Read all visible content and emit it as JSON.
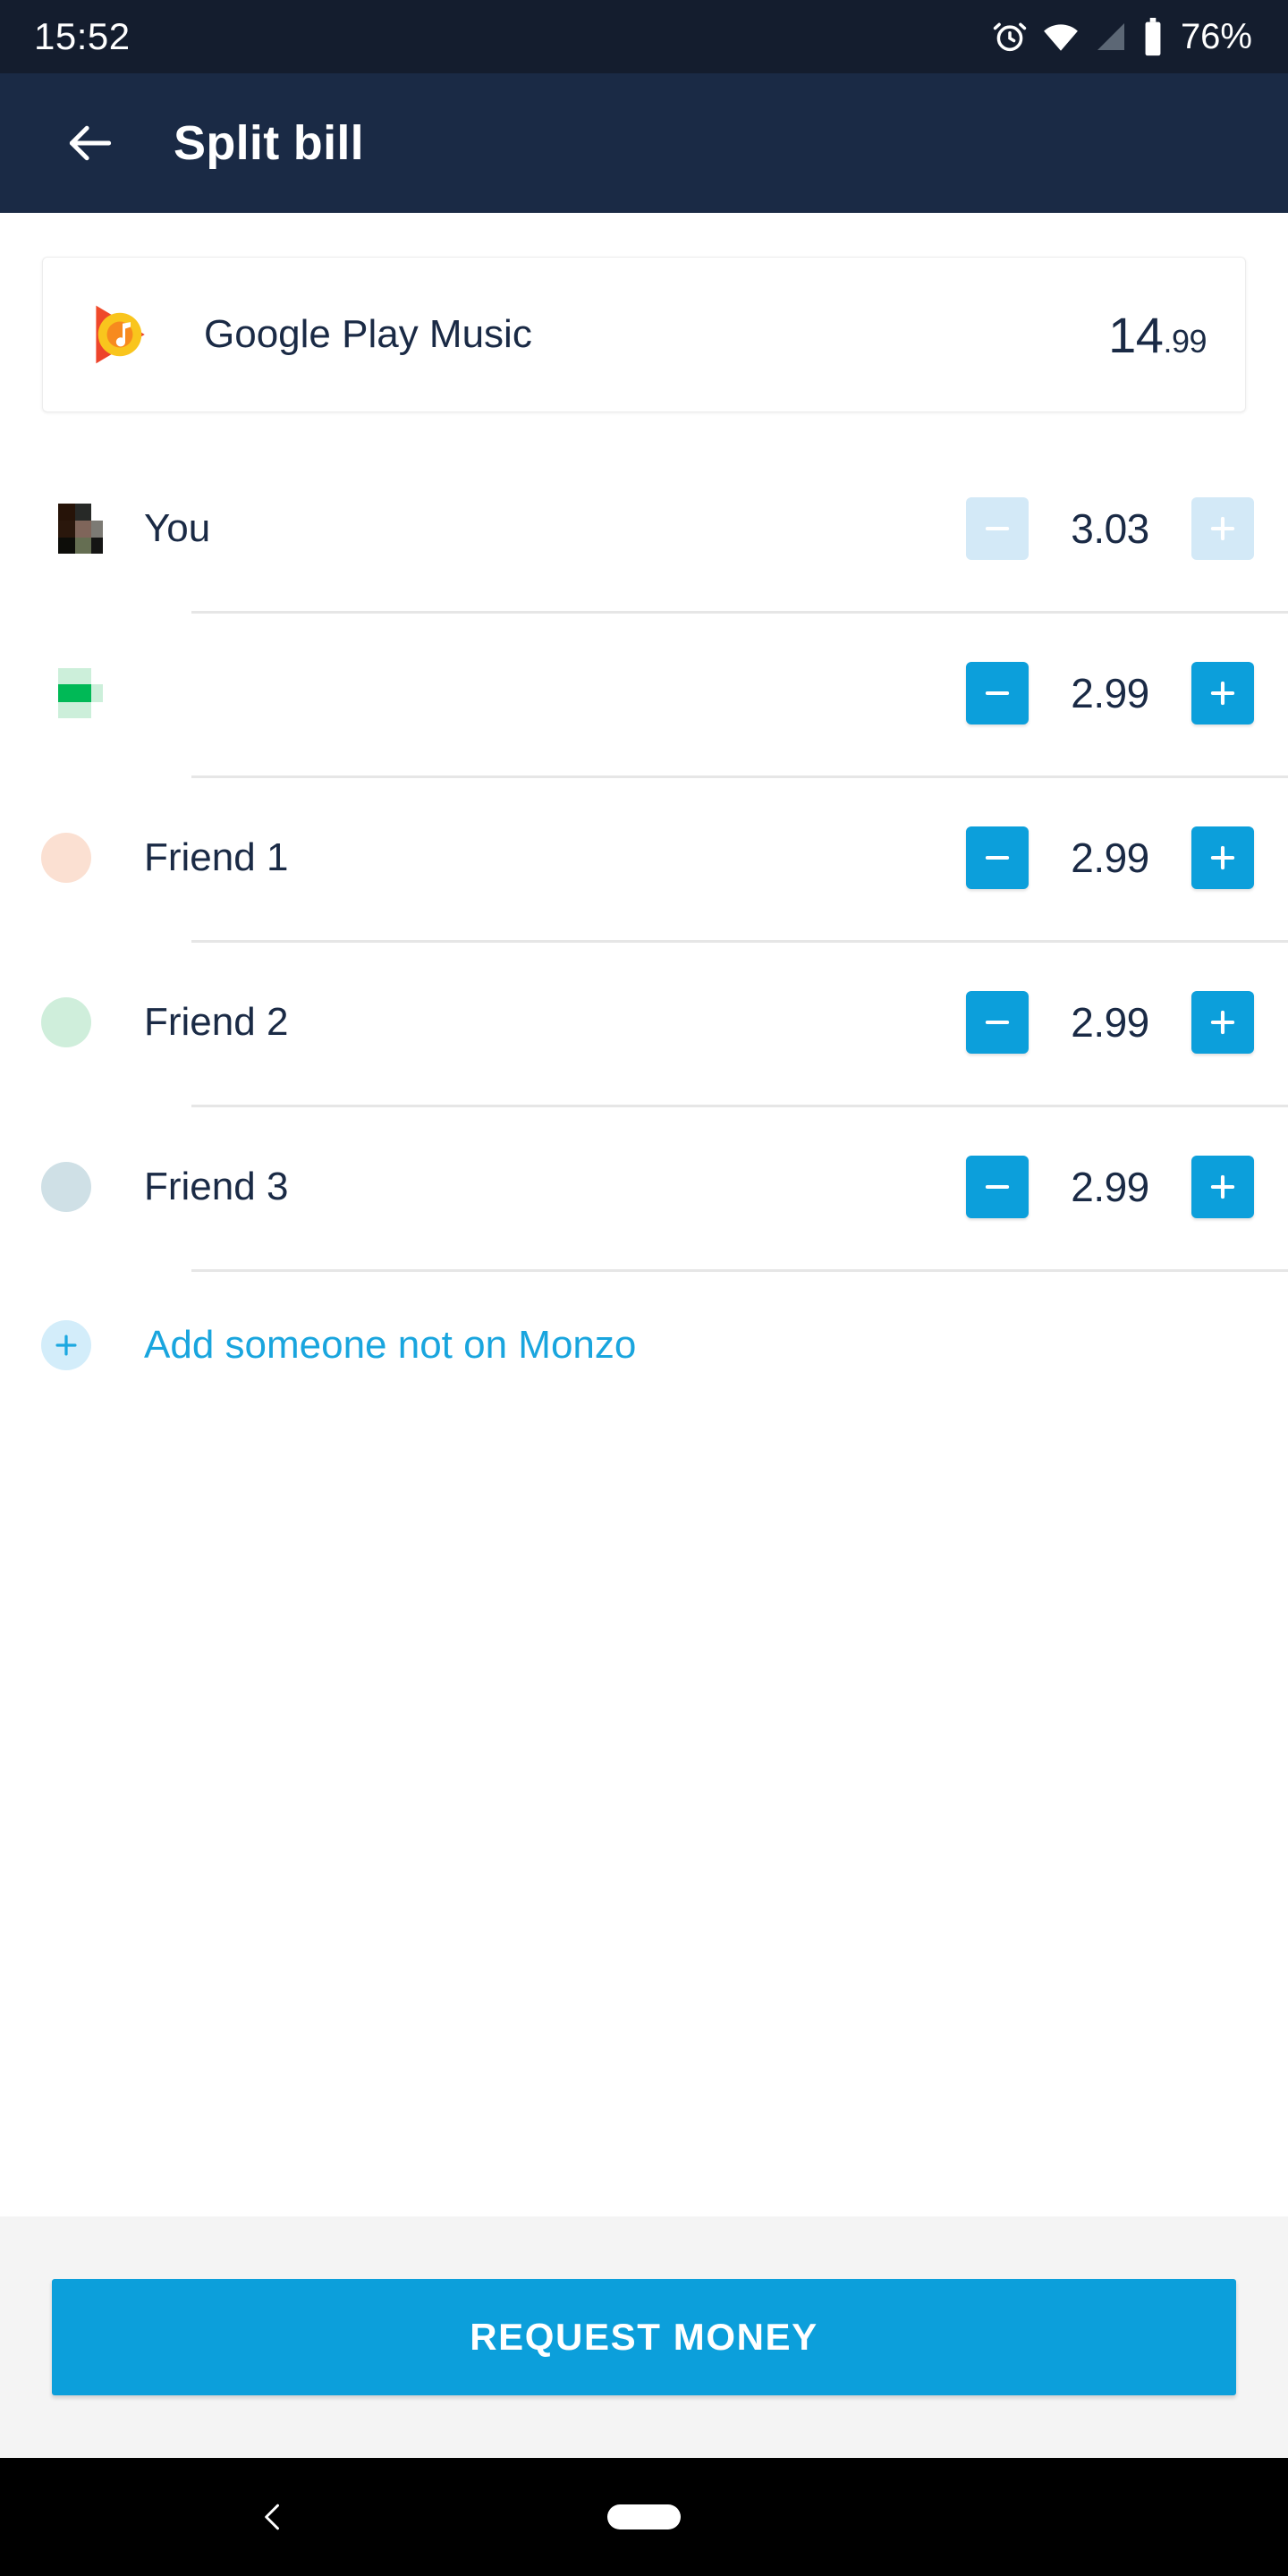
{
  "status_bar": {
    "time": "15:52",
    "battery_text": "76%",
    "icons": [
      "alarm-icon",
      "wifi-icon",
      "signal-icon",
      "battery-icon"
    ]
  },
  "app_bar": {
    "title": "Split bill",
    "back_icon": "arrow-left-icon"
  },
  "merchant": {
    "logo_icon": "google-play-music-icon",
    "name": "Google Play Music",
    "amount_major": "14",
    "amount_minor": ".99"
  },
  "people": [
    {
      "name": "You",
      "amount": "3.03",
      "avatar_type": "pixelated-dark",
      "minus_enabled": false,
      "plus_enabled": false,
      "minus_icon": "minus-icon",
      "plus_icon": "plus-icon"
    },
    {
      "name": "",
      "amount": "2.99",
      "avatar_type": "pixelated-green",
      "minus_enabled": true,
      "plus_enabled": true,
      "minus_icon": "minus-icon",
      "plus_icon": "plus-icon"
    },
    {
      "name": "Friend 1",
      "amount": "2.99",
      "avatar_type": "circle-peach",
      "minus_enabled": true,
      "plus_enabled": true,
      "minus_icon": "minus-icon",
      "plus_icon": "plus-icon"
    },
    {
      "name": "Friend 2",
      "amount": "2.99",
      "avatar_type": "circle-mint",
      "minus_enabled": true,
      "plus_enabled": true,
      "minus_icon": "minus-icon",
      "plus_icon": "plus-icon"
    },
    {
      "name": "Friend 3",
      "amount": "2.99",
      "avatar_type": "circle-blue",
      "minus_enabled": true,
      "plus_enabled": true,
      "minus_icon": "minus-icon",
      "plus_icon": "plus-icon"
    }
  ],
  "add_row": {
    "label": "Add someone not on Monzo",
    "icon": "plus-icon"
  },
  "footer": {
    "request_label": "REQUEST MONEY"
  },
  "nav_bar": {
    "back_icon": "chevron-left-icon",
    "home_icon": "home-pill-icon"
  },
  "colors": {
    "status_bar_bg": "#141D2E",
    "app_bar_bg": "#1A2A45",
    "accent_blue": "#0C9FDB",
    "accent_blue_disabled": "#D3E9F7",
    "link_blue": "#19A5DE",
    "text_dark": "#1A2A45",
    "divider": "#E6E6E6",
    "footer_bg": "#F4F4F4",
    "avatar_peach": "#FBE0D2",
    "avatar_mint": "#CFEEDB",
    "avatar_blue": "#CFE0E6",
    "avatar_green": "#00B956"
  }
}
